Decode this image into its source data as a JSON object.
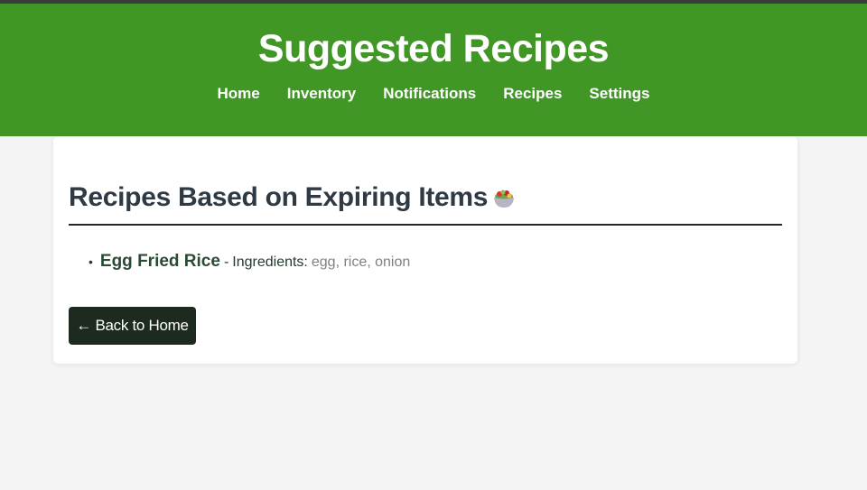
{
  "header": {
    "title": "Suggested Recipes",
    "nav": [
      "Home",
      "Inventory",
      "Notifications",
      "Recipes",
      "Settings"
    ]
  },
  "section": {
    "heading": "Recipes Based on Expiring Items",
    "heading_icon": "salad-bowl-icon"
  },
  "recipes": [
    {
      "name": "Egg Fried Rice",
      "separator": "-",
      "ingredients_label": "Ingredients:",
      "ingredients": "egg, rice, onion"
    }
  ],
  "back_button": {
    "label": "← Back to Home"
  },
  "colors": {
    "header": "#419726",
    "button": "#1d2a20",
    "background": "#f4f4f4"
  }
}
